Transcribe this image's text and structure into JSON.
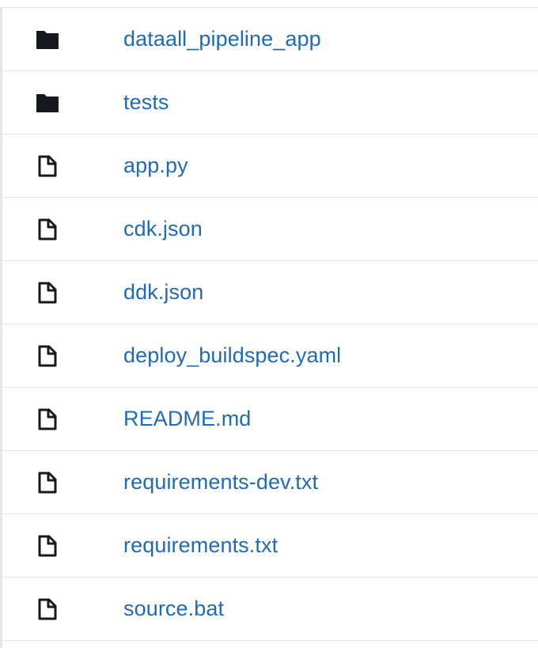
{
  "files": [
    {
      "name": "dataall_pipeline_app",
      "icon": "folder-icon",
      "type": "folder"
    },
    {
      "name": "tests",
      "icon": "folder-icon",
      "type": "folder"
    },
    {
      "name": "app.py",
      "icon": "file-icon",
      "type": "file"
    },
    {
      "name": "cdk.json",
      "icon": "file-icon",
      "type": "file"
    },
    {
      "name": "ddk.json",
      "icon": "file-icon",
      "type": "file"
    },
    {
      "name": "deploy_buildspec.yaml",
      "icon": "file-icon",
      "type": "file"
    },
    {
      "name": "README.md",
      "icon": "file-icon",
      "type": "file"
    },
    {
      "name": "requirements-dev.txt",
      "icon": "file-icon",
      "type": "file"
    },
    {
      "name": "requirements.txt",
      "icon": "file-icon",
      "type": "file"
    },
    {
      "name": "source.bat",
      "icon": "file-icon",
      "type": "file"
    }
  ],
  "colors": {
    "link": "#1f6bb5",
    "icon": "#16191f",
    "divider": "#e3e6e8"
  }
}
